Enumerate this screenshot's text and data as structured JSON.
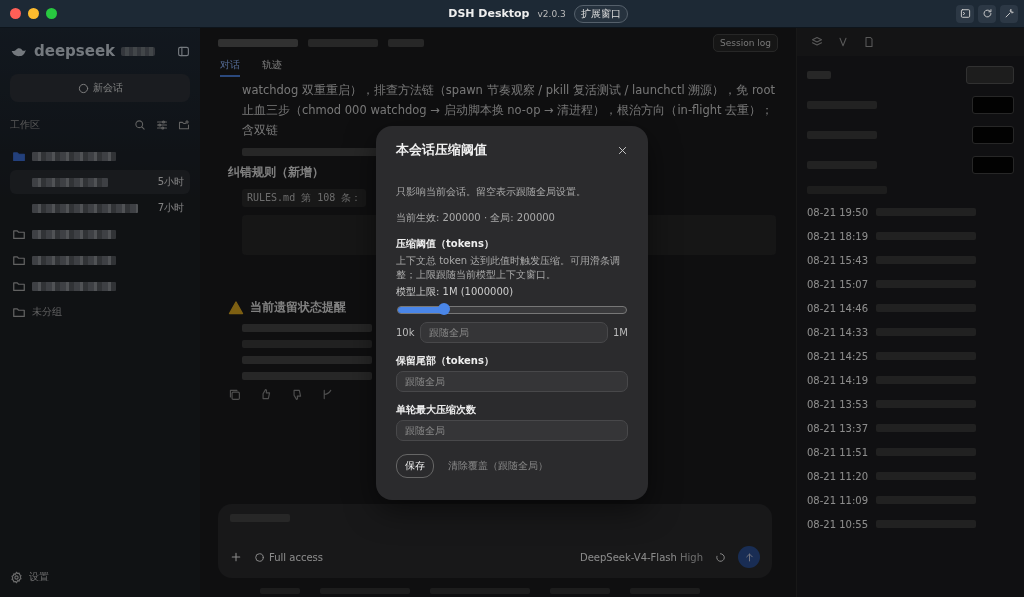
{
  "window": {
    "title": "DSH Desktop",
    "version": "v2.0.3",
    "expand_button": "扩展窗口"
  },
  "sidebar": {
    "logo": "deepseek",
    "new_chat": "新会话",
    "section": "工作区",
    "tree": [
      {
        "kind": "folder",
        "expanded": true,
        "children": [
          {
            "kind": "session",
            "time": "5小时",
            "selected": true
          },
          {
            "kind": "session",
            "time": "7小时",
            "selected": false
          }
        ]
      },
      {
        "kind": "folder",
        "expanded": false
      },
      {
        "kind": "folder",
        "expanded": false
      },
      {
        "kind": "folder",
        "expanded": false
      },
      {
        "kind": "folder",
        "label": "未分组",
        "expanded": false
      }
    ],
    "settings": "设置"
  },
  "main": {
    "session_log": "Session log",
    "tabs": [
      {
        "label": "对话",
        "selected": true
      },
      {
        "label": "轨迹",
        "selected": false
      }
    ],
    "paragraph": "watchdog 双重重启），排查方法链（spawn 节奏观察 / pkill 复活测试 / launchctl 溯源），免 root 止血三步（chmod 000 watchdog → 启动脚本换 no-op → 清进程），根治方向（in-flight 去重）；含双链",
    "heading_rules": "纠错规则（新增）",
    "rule": "RULES.md 第 108 条：",
    "heading_status": "当前遗留状态提醒",
    "composer": {
      "access": "Full access",
      "model": "DeepSeek-V4-Flash",
      "effort": "High"
    }
  },
  "right_panel": {
    "log": [
      {
        "time": "08-21 19:50"
      },
      {
        "time": "08-21 18:19"
      },
      {
        "time": "08-21 15:43"
      },
      {
        "time": "08-21 15:07"
      },
      {
        "time": "08-21 14:46"
      },
      {
        "time": "08-21 14:33"
      },
      {
        "time": "08-21 14:25"
      },
      {
        "time": "08-21 14:19"
      },
      {
        "time": "08-21 13:53"
      },
      {
        "time": "08-21 13:37"
      },
      {
        "time": "08-21 11:51"
      },
      {
        "time": "08-21 11:20"
      },
      {
        "time": "08-21 11:09"
      },
      {
        "time": "08-21 10:55"
      }
    ]
  },
  "dialog": {
    "title": "本会话压缩阈值",
    "description": "只影响当前会话。留空表示跟随全局设置。",
    "current": "当前生效: 200000 · 全局: 200000",
    "fields": [
      {
        "kind": "slider",
        "label": "压缩阈值（tokens）",
        "help": "上下文总 token 达到此值时触发压缩。可用滑条调整；上限跟随当前模型上下文窗口。",
        "limit": "模型上限: 1M (1000000)",
        "level": 0.2,
        "min": "10k",
        "max": "1M",
        "placeholder": "跟随全局"
      },
      {
        "kind": "input",
        "label": "保留尾部（tokens）",
        "placeholder": "跟随全局"
      },
      {
        "kind": "input",
        "label": "单轮最大压缩次数",
        "placeholder": "跟随全局"
      }
    ],
    "save": "保存",
    "clear": "清除覆盖（跟随全局）"
  }
}
